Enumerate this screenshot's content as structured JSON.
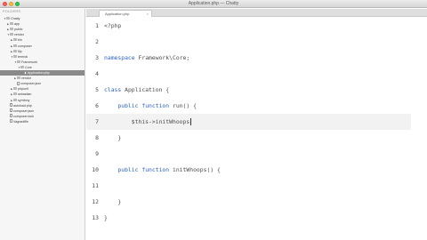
{
  "window": {
    "title": "Application.php — Chatty"
  },
  "sidebar": {
    "header": "FOLDERS",
    "items": [
      {
        "label": "Chatty",
        "type": "folder",
        "expanded": true,
        "selected": false
      },
      {
        "label": "app",
        "type": "folder",
        "expanded": false,
        "selected": false
      },
      {
        "label": "public",
        "type": "folder",
        "expanded": false,
        "selected": false
      },
      {
        "label": "vendor",
        "type": "folder",
        "expanded": true,
        "selected": false
      },
      {
        "label": "bin",
        "type": "folder",
        "expanded": false,
        "selected": false
      },
      {
        "label": "composer",
        "type": "folder",
        "expanded": false,
        "selected": false
      },
      {
        "label": "filp",
        "type": "folder",
        "expanded": false,
        "selected": false
      },
      {
        "label": "tererok",
        "type": "folder",
        "expanded": true,
        "selected": false
      },
      {
        "label": "Framework",
        "type": "folder",
        "expanded": true,
        "selected": false
      },
      {
        "label": "Core",
        "type": "folder",
        "expanded": true,
        "selected": false
      },
      {
        "label": "Application.php",
        "type": "file",
        "expanded": false,
        "selected": true
      },
      {
        "label": "vendor",
        "type": "folder",
        "expanded": false,
        "selected": false
      },
      {
        "label": "composer.json",
        "type": "file",
        "expanded": false,
        "selected": false
      },
      {
        "label": "phpunit",
        "type": "folder",
        "expanded": false,
        "selected": false
      },
      {
        "label": "sebastian",
        "type": "folder",
        "expanded": false,
        "selected": false
      },
      {
        "label": "symfony",
        "type": "folder",
        "expanded": false,
        "selected": false
      },
      {
        "label": "autoload.php",
        "type": "file",
        "expanded": false,
        "selected": false
      },
      {
        "label": "composer.json",
        "type": "file",
        "expanded": false,
        "selected": false
      },
      {
        "label": "composer.lock",
        "type": "file",
        "expanded": false,
        "selected": false
      },
      {
        "label": "Vagrantfile",
        "type": "file",
        "expanded": false,
        "selected": false
      }
    ]
  },
  "tabs": [
    {
      "label": "Application.php",
      "close": "×",
      "active": true
    }
  ],
  "editor": {
    "current_line": 7,
    "lines": [
      {
        "num": "1",
        "text": "<?php"
      },
      {
        "num": "2",
        "text": ""
      },
      {
        "num": "3",
        "text": "namespace Framework\\Core;"
      },
      {
        "num": "4",
        "text": ""
      },
      {
        "num": "5",
        "text": "class Application {"
      },
      {
        "num": "6",
        "text": "    public function run() {"
      },
      {
        "num": "7",
        "text": "        $this->initWhoops"
      },
      {
        "num": "8",
        "text": "    }"
      },
      {
        "num": "9",
        "text": ""
      },
      {
        "num": "10",
        "text": "    public function initWhoops() {"
      },
      {
        "num": "11",
        "text": ""
      },
      {
        "num": "12",
        "text": "    }"
      },
      {
        "num": "13",
        "text": "}"
      }
    ]
  }
}
